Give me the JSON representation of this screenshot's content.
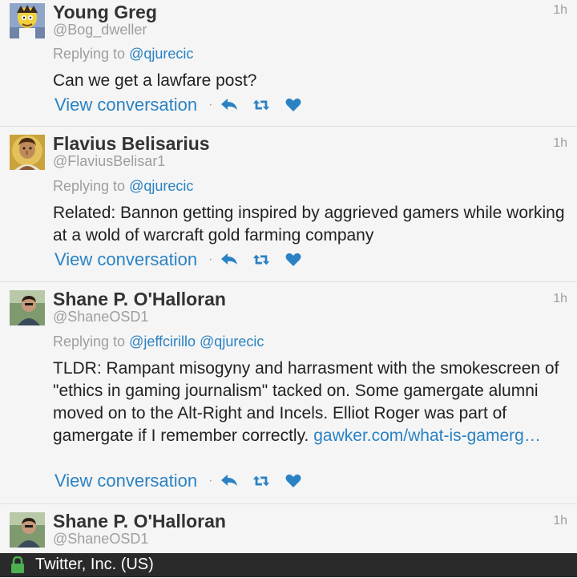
{
  "feed": {
    "tweets": [
      {
        "name": "Young Greg",
        "handle": "@Bog_dweller",
        "time": "1h",
        "replying_prefix": "Replying to",
        "replying_to": "@qjurecic",
        "text": "Can we get a lawfare post?",
        "view_conversation": "View conversation"
      },
      {
        "name": "Flavius Belisarius",
        "handle": "@FlaviusBelisar1",
        "time": "1h",
        "replying_prefix": "Replying to",
        "replying_to": "@qjurecic",
        "text": "Related: Bannon getting inspired by aggrieved gamers while working at a wold of warcraft gold farming company",
        "view_conversation": "View conversation"
      },
      {
        "name": "Shane P. O'Halloran",
        "handle": "@ShaneOSD1",
        "time": "1h",
        "replying_prefix": "Replying to",
        "replying_to": "@jeffcirillo @qjurecic",
        "text": "TLDR: Rampant misogyny and harrasment with the smokescreen of \"ethics in gaming journalism\" tacked on. Some gamergate alumni moved on to the Alt-Right and Incels. Elliot Roger was part of gamergate if I remember correctly.",
        "link": "gawker.com/what-is-gamerg…",
        "view_conversation": "View conversation"
      },
      {
        "name": "Shane P. O'Halloran",
        "handle": "@ShaneOSD1",
        "time": "1h"
      }
    ]
  },
  "icons": {
    "reply": "reply-arrow-icon",
    "retweet": "retweet-icon",
    "like": "heart-icon",
    "lock": "lock-icon"
  },
  "colors": {
    "link": "#2a82c4",
    "muted": "#9e9e9e",
    "status_bar": "#2a2a2a",
    "lock": "#4caf50"
  },
  "status_bar": {
    "label": "Twitter, Inc. (US)"
  }
}
